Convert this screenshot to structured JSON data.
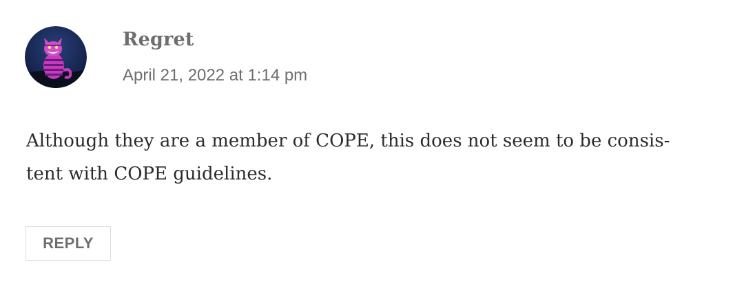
{
  "comment": {
    "author": "Regret",
    "date": "April 21, 2022 at 1:14 pm",
    "body_line_1": "Although they are a member of COPE, this does not seem to be consis-",
    "body_line_2": "tent with COPE guidelines.",
    "reply_label": "REPLY",
    "avatar_icon": "cheshire-cat-avatar"
  }
}
